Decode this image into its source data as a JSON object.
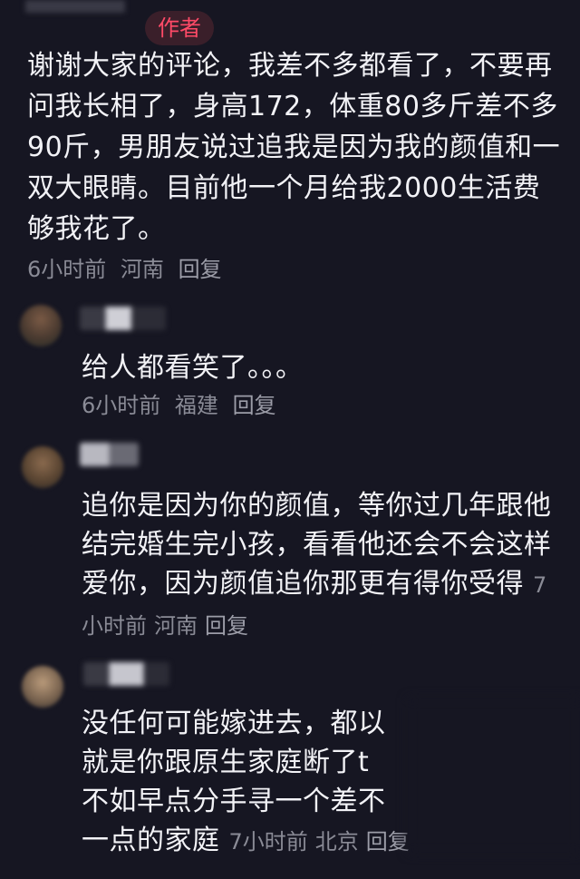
{
  "author_badge": "作者",
  "main_comment": {
    "text": "谢谢大家的评论，我差不多都看了，不要再问我长相了，身高172，体重80多斤差不多90斤，男朋友说过追我是因为我的颜值和一双大眼睛。目前他一个月给我2000生活费够我花了。",
    "time": "6小时前",
    "location": "河南",
    "reply_label": "回复"
  },
  "replies": [
    {
      "text": "给人都看笑了。。。",
      "time": "6小时前",
      "location": "福建",
      "reply_label": "回复"
    },
    {
      "text": "追你是因为你的颜值，等你过几年跟他结完婚生完小孩，看看他还会不会这样爱你，因为颜值追你那更有得你受得",
      "time": "7小时前",
      "location": "河南",
      "reply_label": "回复"
    },
    {
      "line1": "没任何可能嫁进去，都以",
      "line2": "就是你跟原生家庭断了t",
      "line3": "不如早点分手寻一个差不",
      "line4": "一点的家庭",
      "time": "7小时前",
      "location": "北京",
      "reply_label": "回复"
    }
  ],
  "colors": {
    "background": "#161622",
    "text": "#f2f2f6",
    "meta": "#8a8b96",
    "author_badge": "#ff4a67"
  }
}
